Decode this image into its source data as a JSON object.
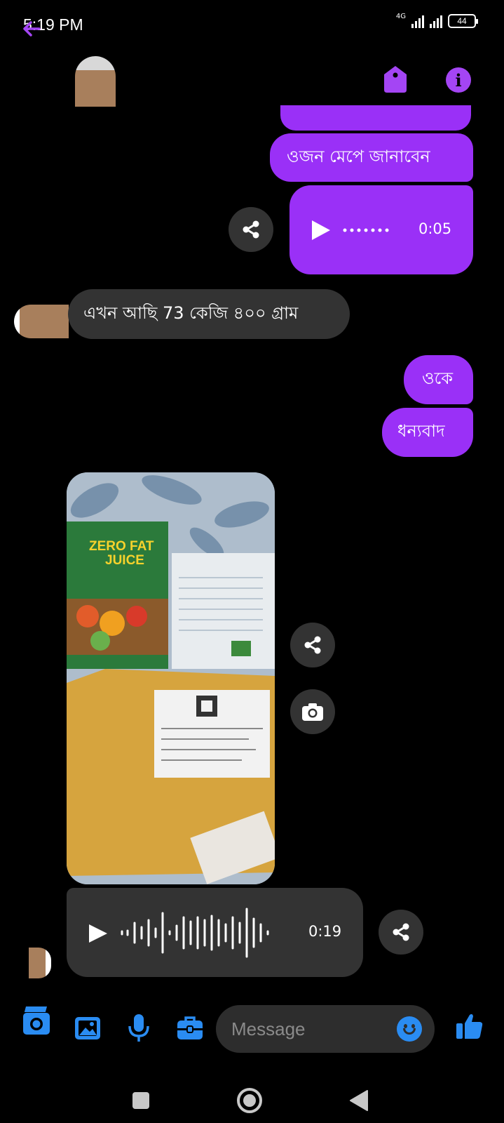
{
  "status_bar": {
    "time": "5:19 PM",
    "network": "4G",
    "battery": "44"
  },
  "header": {
    "back_icon": "arrow-left-icon",
    "tag_icon": "tag-icon",
    "info_icon": "info-icon",
    "info_glyph": "i",
    "accent_color": "#a445f4"
  },
  "messages": [
    {
      "direction": "outgoing",
      "type": "text",
      "text": "ওজন মেপে জানাবেন"
    },
    {
      "direction": "outgoing",
      "type": "audio",
      "duration": "0:05"
    },
    {
      "direction": "incoming",
      "type": "text",
      "text": "এখন আছি 73 কেজি ৪০০ গ্রাম"
    },
    {
      "direction": "outgoing",
      "type": "text",
      "text": "ওকে"
    },
    {
      "direction": "outgoing",
      "type": "text",
      "text": "ধন্যবাদ"
    },
    {
      "direction": "incoming",
      "type": "photo",
      "product_brand": "ZERO FAT",
      "product_name": "JUICE"
    },
    {
      "direction": "incoming",
      "type": "audio",
      "duration": "0:19"
    }
  ],
  "composer": {
    "placeholder": "Message",
    "icons": [
      "camera-icon",
      "image-icon",
      "microphone-icon",
      "toolbox-icon",
      "emoji-icon",
      "thumbs-up-icon"
    ]
  },
  "navbar": {
    "icons": [
      "recents-square-icon",
      "home-circle-icon",
      "back-triangle-icon"
    ]
  },
  "colors": {
    "outgoing_bubble": "#9a30f7",
    "incoming_bubble": "#333333",
    "composer_icons": "#2a8cf2"
  }
}
